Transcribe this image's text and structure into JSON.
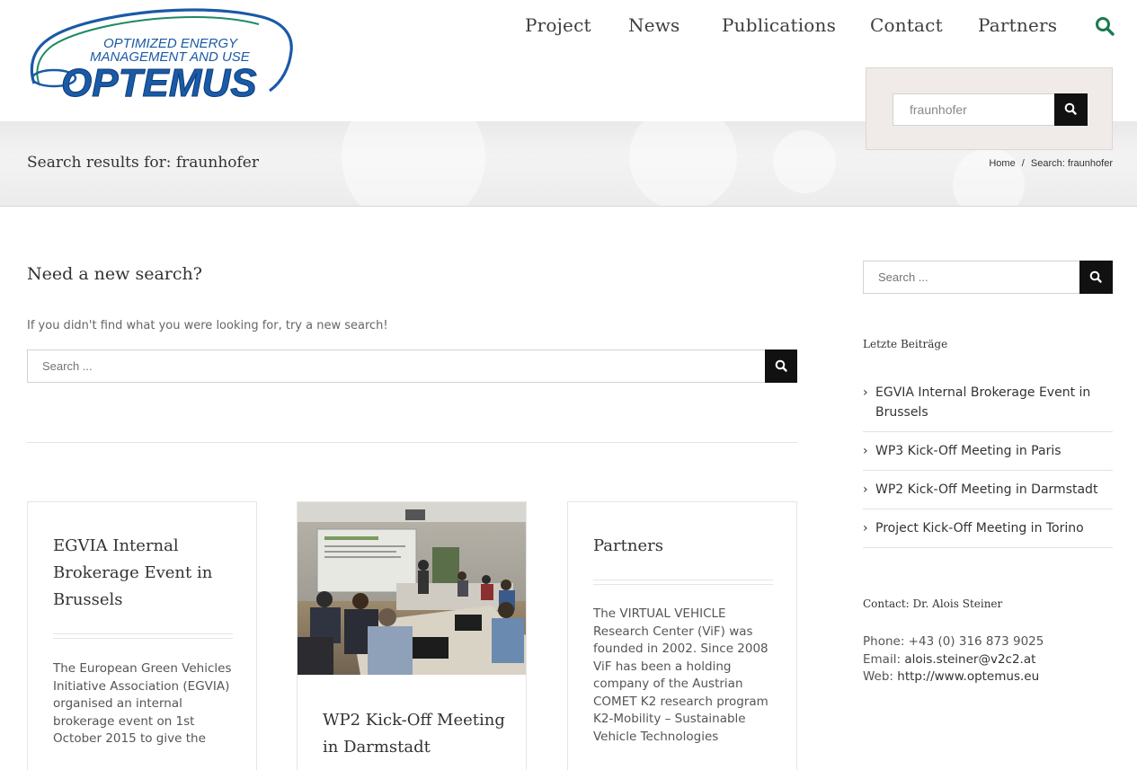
{
  "logo": {
    "line1": "OPTIMIZED ENERGY",
    "line2": "MANAGEMENT AND USE",
    "brand": "OPTEMUS"
  },
  "nav": {
    "items": [
      {
        "label": "Project"
      },
      {
        "label": "News"
      },
      {
        "label": "Publications"
      },
      {
        "label": "Contact"
      },
      {
        "label": "Partners"
      }
    ],
    "search_icon": "search-icon"
  },
  "dropdown_search": {
    "value": "fraunhofer"
  },
  "title_bar": {
    "title": "Search results for: fraunhofer",
    "breadcrumb_home": "Home",
    "breadcrumb_sep": "/",
    "breadcrumb_current": "Search: fraunhofer"
  },
  "main": {
    "heading": "Need a new search?",
    "text": "If you didn't find what you were looking for, try a new search!",
    "search_placeholder": "Search ..."
  },
  "cards": [
    {
      "title": "EGVIA Internal Brokerage Event in Brussels",
      "excerpt": "The European Green Vehicles Initiative Association (EGVIA) organised an internal brokerage event on 1st October 2015 to give the"
    },
    {
      "title": "WP2 Kick-Off Meeting in Darmstadt",
      "image": "meeting-photo"
    },
    {
      "title": "Partners",
      "excerpt": "The VIRTUAL VEHICLE Research Center (ViF) was founded in 2002. Since 2008 ViF has been a holding company of the Austrian COMET K2 research program K2-Mobility – Sustainable Vehicle Technologies"
    }
  ],
  "sidebar": {
    "search_placeholder": "Search ...",
    "recent_heading": "Letzte Beiträge",
    "recent": [
      {
        "label": "EGVIA Internal Brokerage Event in Brussels"
      },
      {
        "label": "WP3 Kick-Off Meeting in Paris"
      },
      {
        "label": "WP2 Kick-Off Meeting in Darmstadt"
      },
      {
        "label": "Project Kick-Off Meeting in Torino"
      }
    ],
    "contact_heading": "Contact: Dr. Alois Steiner",
    "phone_label": "Phone:",
    "phone": "+43 (0) 316 873 9025",
    "email_label": "Email:",
    "email": "alois.steiner@v2c2.at",
    "web_label": "Web:",
    "web": "http://www.optemus.eu"
  },
  "colors": {
    "accent": "#1c7a4e",
    "button_bg": "#111111",
    "dropdown_bg": "#f0ebe9",
    "logo_blue": "#1a5aa6",
    "logo_green": "#1c8a64"
  }
}
